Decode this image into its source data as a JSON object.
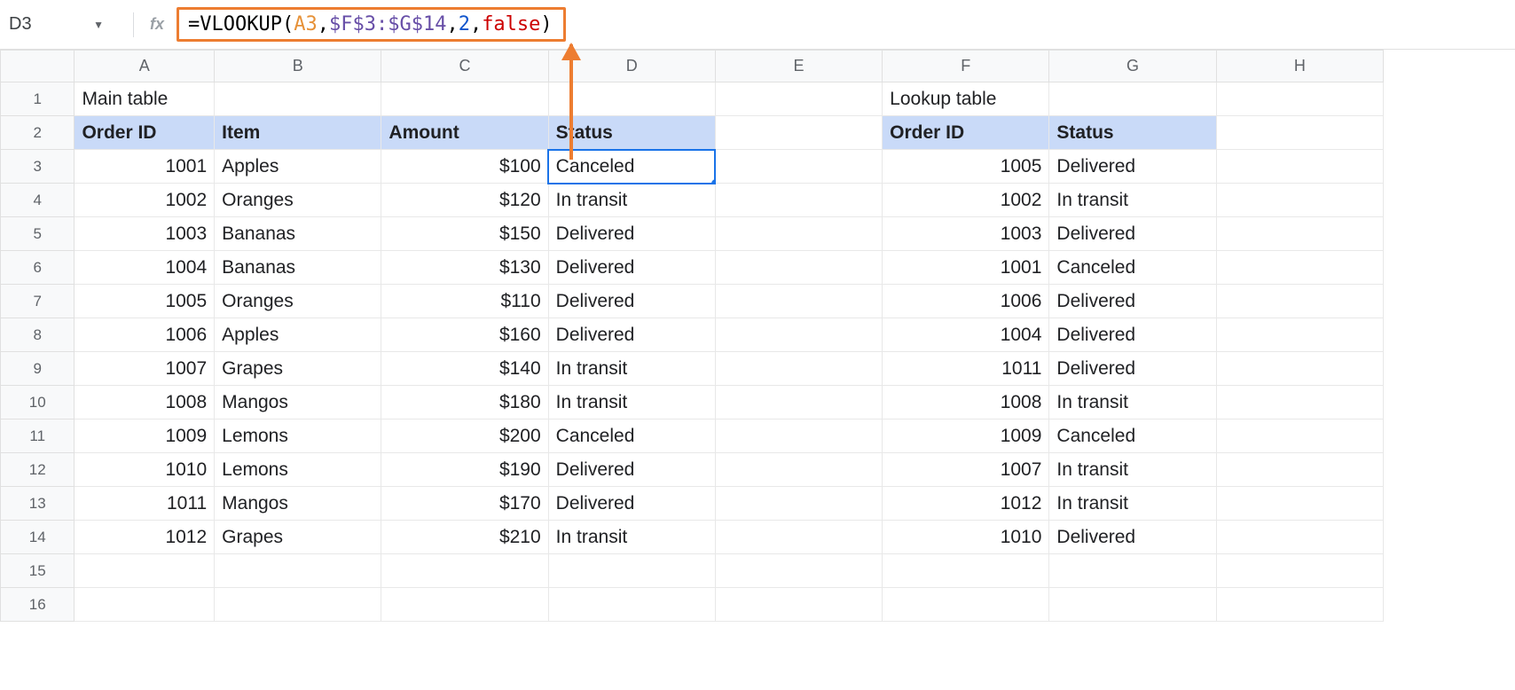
{
  "name_box": "D3",
  "formula": {
    "p1": "=VLOOKUP(",
    "p2": "A3",
    "p3": ",",
    "p4": "$F$3:$G$14",
    "p5": ",",
    "p6": "2",
    "p7": ",",
    "p8": "false",
    "p9": ")"
  },
  "columns": {
    "A": "A",
    "B": "B",
    "C": "C",
    "D": "D",
    "E": "E",
    "F": "F",
    "G": "G",
    "H": "H"
  },
  "row_labels": [
    "1",
    "2",
    "3",
    "4",
    "5",
    "6",
    "7",
    "8",
    "9",
    "10",
    "11",
    "12",
    "13",
    "14",
    "15",
    "16"
  ],
  "titles": {
    "main": "Main table",
    "lookup": "Lookup table"
  },
  "main_headers": {
    "a": "Order ID",
    "b": "Item",
    "c": "Amount",
    "d": "Status"
  },
  "lookup_headers": {
    "f": "Order ID",
    "g": "Status"
  },
  "main_rows": [
    {
      "id": "1001",
      "item": "Apples",
      "amount": "$100",
      "status": "Canceled"
    },
    {
      "id": "1002",
      "item": "Oranges",
      "amount": "$120",
      "status": "In transit"
    },
    {
      "id": "1003",
      "item": "Bananas",
      "amount": "$150",
      "status": "Delivered"
    },
    {
      "id": "1004",
      "item": "Bananas",
      "amount": "$130",
      "status": "Delivered"
    },
    {
      "id": "1005",
      "item": "Oranges",
      "amount": "$110",
      "status": "Delivered"
    },
    {
      "id": "1006",
      "item": "Apples",
      "amount": "$160",
      "status": "Delivered"
    },
    {
      "id": "1007",
      "item": "Grapes",
      "amount": "$140",
      "status": "In transit"
    },
    {
      "id": "1008",
      "item": "Mangos",
      "amount": "$180",
      "status": "In transit"
    },
    {
      "id": "1009",
      "item": "Lemons",
      "amount": "$200",
      "status": "Canceled"
    },
    {
      "id": "1010",
      "item": "Lemons",
      "amount": "$190",
      "status": "Delivered"
    },
    {
      "id": "1011",
      "item": "Mangos",
      "amount": "$170",
      "status": "Delivered"
    },
    {
      "id": "1012",
      "item": "Grapes",
      "amount": "$210",
      "status": "In transit"
    }
  ],
  "lookup_rows": [
    {
      "id": "1005",
      "status": "Delivered"
    },
    {
      "id": "1002",
      "status": "In transit"
    },
    {
      "id": "1003",
      "status": "Delivered"
    },
    {
      "id": "1001",
      "status": "Canceled"
    },
    {
      "id": "1006",
      "status": "Delivered"
    },
    {
      "id": "1004",
      "status": "Delivered"
    },
    {
      "id": "1011",
      "status": "Delivered"
    },
    {
      "id": "1008",
      "status": "In transit"
    },
    {
      "id": "1009",
      "status": "Canceled"
    },
    {
      "id": "1007",
      "status": "In transit"
    },
    {
      "id": "1012",
      "status": "In transit"
    },
    {
      "id": "1010",
      "status": "Delivered"
    }
  ]
}
